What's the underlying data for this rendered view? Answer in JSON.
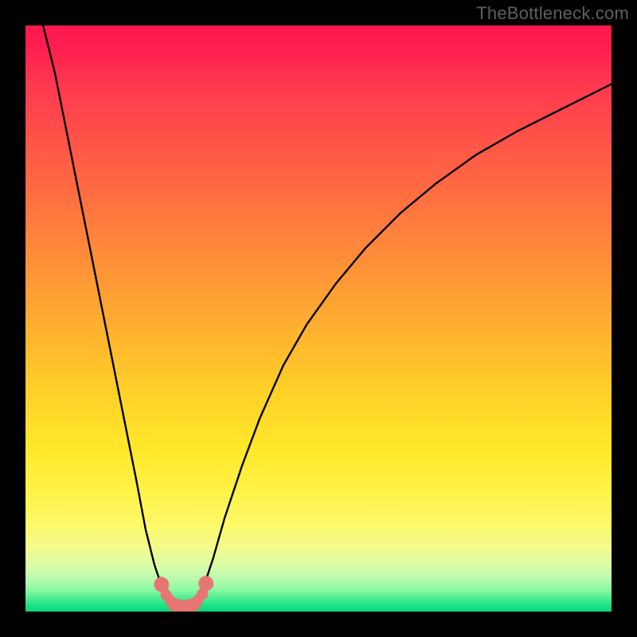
{
  "watermark": "TheBottleneck.com",
  "colors": {
    "background_black": "#000000",
    "gradient_top": "#ff1850",
    "gradient_mid": "#ffe72a",
    "gradient_bottom": "#05d97d",
    "curve_stroke": "#000000",
    "marker_pink": "#e77573",
    "watermark_text": "#5f5f5f"
  },
  "chart_data": {
    "type": "line",
    "title": "",
    "xlabel": "",
    "ylabel": "",
    "xlim": [
      0,
      100
    ],
    "ylim": [
      0,
      100
    ],
    "grid": false,
    "series": [
      {
        "name": "left-descending-curve",
        "x": [
          3,
          5,
          7,
          9,
          11,
          13,
          15,
          17,
          19,
          20.5,
          22,
          23,
          24,
          25,
          26
        ],
        "y": [
          100,
          92,
          82,
          72,
          62,
          52,
          42,
          32,
          22,
          14,
          8,
          5,
          3,
          1.5,
          0.7
        ]
      },
      {
        "name": "right-ascending-curve",
        "x": [
          29,
          30,
          32,
          34,
          37,
          40,
          44,
          48,
          53,
          58,
          64,
          70,
          77,
          84,
          92,
          100
        ],
        "y": [
          0.7,
          3,
          9,
          16,
          25,
          33,
          42,
          49,
          56,
          62,
          68,
          73,
          78,
          82,
          86,
          90
        ]
      },
      {
        "name": "marker-cluster-u-shape",
        "x": [
          23.2,
          24.0,
          24.8,
          25.6,
          26.6,
          27.6,
          28.6,
          29.4,
          30.2,
          30.8
        ],
        "y": [
          4.6,
          2.8,
          1.6,
          0.8,
          0.5,
          0.5,
          0.9,
          1.7,
          3.0,
          4.8
        ]
      }
    ],
    "annotations": []
  }
}
